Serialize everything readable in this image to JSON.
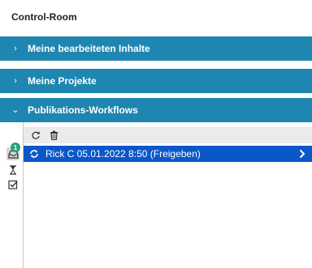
{
  "title": "Control-Room",
  "sections": [
    {
      "label": "Meine bearbeiteten Inhalte",
      "chevron": "›",
      "expanded": false
    },
    {
      "label": "Meine Projekte",
      "chevron": "›",
      "expanded": false
    },
    {
      "label": "Publikations-Workflows",
      "chevron": "⌄",
      "expanded": true
    }
  ],
  "toolbar": {
    "icons": [
      "refresh-icon",
      "trash-icon"
    ]
  },
  "side_icons": [
    "inbox-icon",
    "hourglass-icon",
    "checklist-icon"
  ],
  "badge_count": "1",
  "workflow_rows": [
    {
      "icon": "workflow-cycle-icon",
      "label": "Rick C 05.01.2022 8:50 (Freigeben)",
      "selected": true
    }
  ],
  "colors": {
    "section_bg": "#1e86b0",
    "selected_row_bg": "#0a57c9",
    "toolbar_bg": "#ebebeb",
    "badge_bg": "#2aa07a"
  }
}
